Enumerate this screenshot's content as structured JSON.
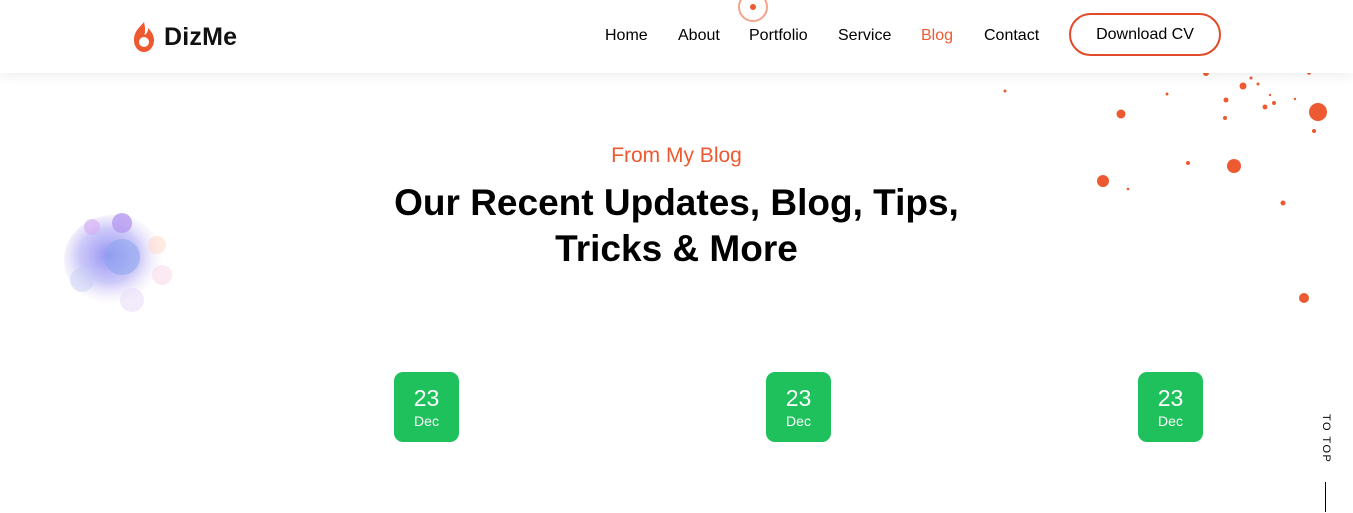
{
  "brand": {
    "name": "DizMe",
    "accent": "#ed5a31"
  },
  "nav": {
    "items": [
      {
        "label": "Home"
      },
      {
        "label": "About"
      },
      {
        "label": "Portfolio"
      },
      {
        "label": "Service"
      },
      {
        "label": "Blog",
        "active": true
      },
      {
        "label": "Contact"
      }
    ],
    "cta_label": "Download CV"
  },
  "section": {
    "subtitle": "From My Blog",
    "title_line1": "Our Recent Updates, Blog, Tips,",
    "title_line2": "Tricks & More"
  },
  "posts": [
    {
      "day": "23",
      "month": "Dec"
    },
    {
      "day": "23",
      "month": "Dec"
    },
    {
      "day": "23",
      "month": "Dec"
    }
  ],
  "badge_color": "#1ec15b",
  "totop_label": "TO TOP",
  "icons": [
    "logo-flame-icon",
    "paint-splatter-icon",
    "watercolor-blob-icon"
  ]
}
